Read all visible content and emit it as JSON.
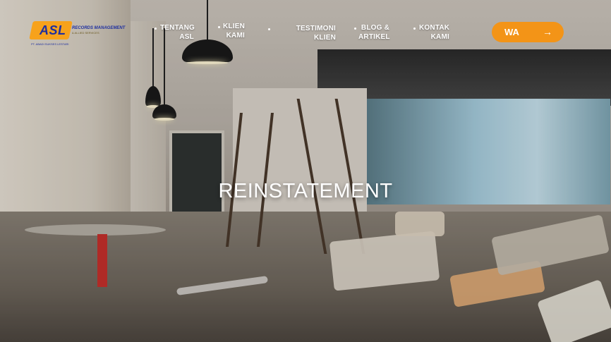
{
  "logo": {
    "brand": "ASL",
    "tagline": "RECORDS MANAGEMENT",
    "subtagline": "& ALLIED SERVICES",
    "caption": "PT. ABADI SUKSES LESTARI"
  },
  "nav": {
    "items": [
      {
        "label_line1": "TENTANG",
        "label_line2": "ASL"
      },
      {
        "label_line1": "KLIEN",
        "label_line2": "KAMI"
      },
      {
        "label_line1": "TESTIMONI KLIEN",
        "label_line2": ""
      },
      {
        "label_line1": "BLOG &",
        "label_line2": "ARTIKEL"
      },
      {
        "label_line1": "KONTAK",
        "label_line2": "KAMI"
      }
    ],
    "cta": {
      "label": "WA",
      "icon": "arrow-right-icon",
      "color": "#f39417"
    }
  },
  "hero": {
    "title": "REINSTATEMENT"
  },
  "colors": {
    "accent": "#f39417",
    "logo_blue": "#1e2fa0",
    "logo_orange": "#f7a21b"
  }
}
